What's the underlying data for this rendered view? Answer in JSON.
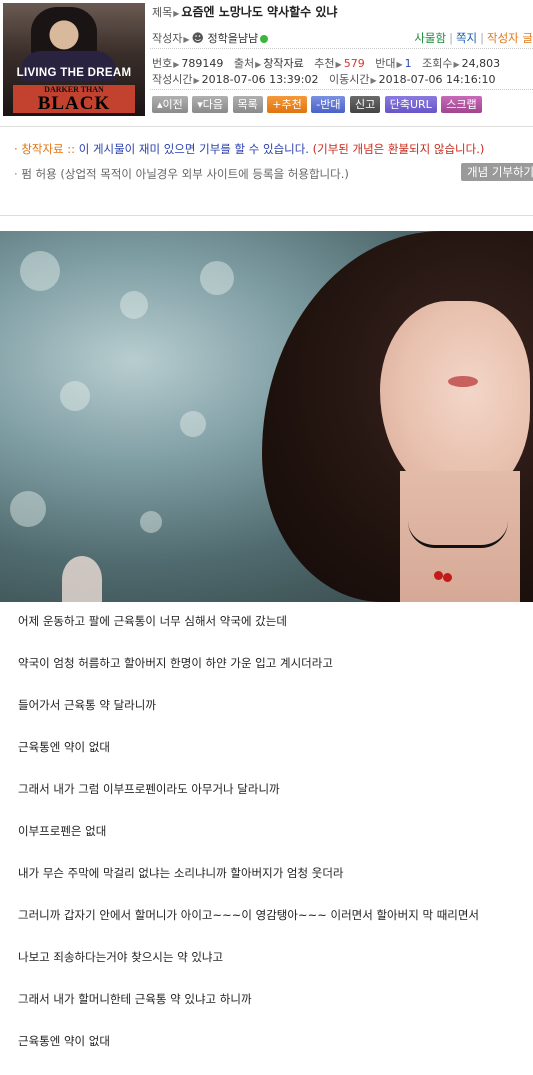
{
  "avatar": {
    "line1": "LIVING THE DREAM",
    "line2": "DARKER THAN",
    "line3": "BLACK"
  },
  "post": {
    "title_label": "제목",
    "title": "요즘엔 노망나도 약사할수 있냐",
    "author_label": "작성자",
    "author": "정학을냠냠",
    "links": {
      "block": "사물함",
      "message": "쪽지",
      "author_posts": "작성자 글"
    },
    "number_label": "번호",
    "number": "789149",
    "source_label": "출처",
    "source": "창작자료",
    "recommend_label": "추천",
    "recommend": "579",
    "oppose_label": "반대",
    "oppose": "1",
    "views_label": "조회수",
    "views": "24,803",
    "created_label": "작성시간",
    "created": "2018-07-06 13:39:02",
    "moved_label": "이동시간",
    "moved": "2018-07-06 14:16:10"
  },
  "toolbar": {
    "prev": "▴이전",
    "next": "▾다음",
    "list": "목록",
    "recommend": "+추천",
    "oppose": "-반대",
    "report": "신고",
    "short_url": "단축URL",
    "scrap": "스크랩"
  },
  "notice": {
    "line1_tag": "창작자료",
    "line1_sep": " :: ",
    "line1_text": "이 게시물이 재미 있으면 기부를 할 수 있습니다. ",
    "line1_warn": "(기부된 개념은 환불되지 않습니다.)",
    "line2_tag": "펌 허용",
    "line2_text": " (상업적 목적이 아닐경우 외부 사이트에 등록을 허용합니다.)",
    "donate_button": "개념 기부하기"
  },
  "content": {
    "paragraphs": [
      "어제 운동하고 팔에 근육통이 너무 심해서 약국에 갔는데",
      "약국이 엄청 허름하고 할아버지 한명이 하얀 가운 입고 계시더라고",
      "들어가서 근육통 약 달라니까",
      "근육통엔 약이 없대",
      "그래서 내가 그럼 이부프로펜이라도 아무거나 달라니까",
      "이부프로펜은 없대",
      "내가 무슨 주막에 막걸리 없냐는 소리냐니까 할아버지가 엄청 웃더라",
      "그러니까 갑자기 안에서 할머니가 아이고~~~이 영감탱아~~~ 이러면서 할아버지 막 때리면서",
      "나보고 죄송하다는거야 찾으시는 약 있냐고",
      "그래서 내가 할머니한테 근육통 약 있냐고 하니까",
      "근육통엔 약이 없대"
    ]
  }
}
